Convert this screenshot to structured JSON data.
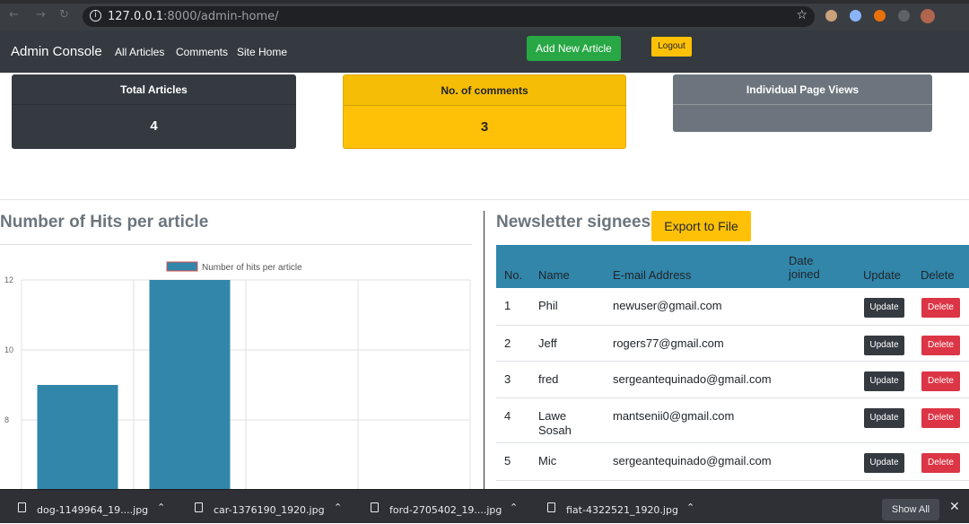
{
  "browser": {
    "url_host": "127.0.0.1",
    "url_path": ":8000/admin-home/"
  },
  "navbar": {
    "brand": "Admin Console",
    "links": [
      "All Articles",
      "Comments",
      "Site Home"
    ],
    "add_article_label": "Add New Article",
    "logout_label": "Logout",
    "colors": {
      "add": "#28a745",
      "logout": "#ffc107",
      "bg": "#343a40"
    }
  },
  "stats": {
    "total_articles": {
      "label": "Total Articles",
      "value": "4"
    },
    "comments": {
      "label": "No. of comments",
      "value": "3"
    },
    "page_views": {
      "label": "Individual Page Views",
      "value": ""
    }
  },
  "chart_section": {
    "title": "Number of Hits per article"
  },
  "chart_data": {
    "type": "bar",
    "legend": "Number of hits per article",
    "legend_position": "top",
    "categories": [
      "",
      "",
      "",
      ""
    ],
    "values": [
      9,
      12,
      null,
      null
    ],
    "y_ticks": [
      "12",
      "10",
      "8"
    ],
    "ylim": [
      6,
      12
    ],
    "color": "#3186aa",
    "grid": true
  },
  "newsletter": {
    "title": "Newsletter signees",
    "export_label": "Export to File",
    "columns": [
      "No.",
      "Name",
      "E-mail Address",
      "Date joined",
      "Update",
      "Delete"
    ],
    "update_label": "Update",
    "delete_label": "Delete",
    "rows": [
      {
        "no": "1",
        "name": "Phil",
        "email": "newuser@gmail.com",
        "date": ""
      },
      {
        "no": "2",
        "name": "Jeff",
        "email": "rogers77@gmail.com",
        "date": ""
      },
      {
        "no": "3",
        "name": "fred",
        "email": "sergeantequinado@gmail.com",
        "date": ""
      },
      {
        "no": "4",
        "name": "Lawe Sosah",
        "email": "mantsenii0@gmail.com",
        "date": ""
      },
      {
        "no": "5",
        "name": "Mic",
        "email": "sergeantequinado@gmail.com",
        "date": ""
      }
    ]
  },
  "downloads": {
    "files": [
      "dog-1149964_19....jpg",
      "car-1376190_1920.jpg",
      "ford-2705402_19....jpg",
      "fiat-4322521_1920.jpg"
    ],
    "show_all_label": "Show All"
  }
}
